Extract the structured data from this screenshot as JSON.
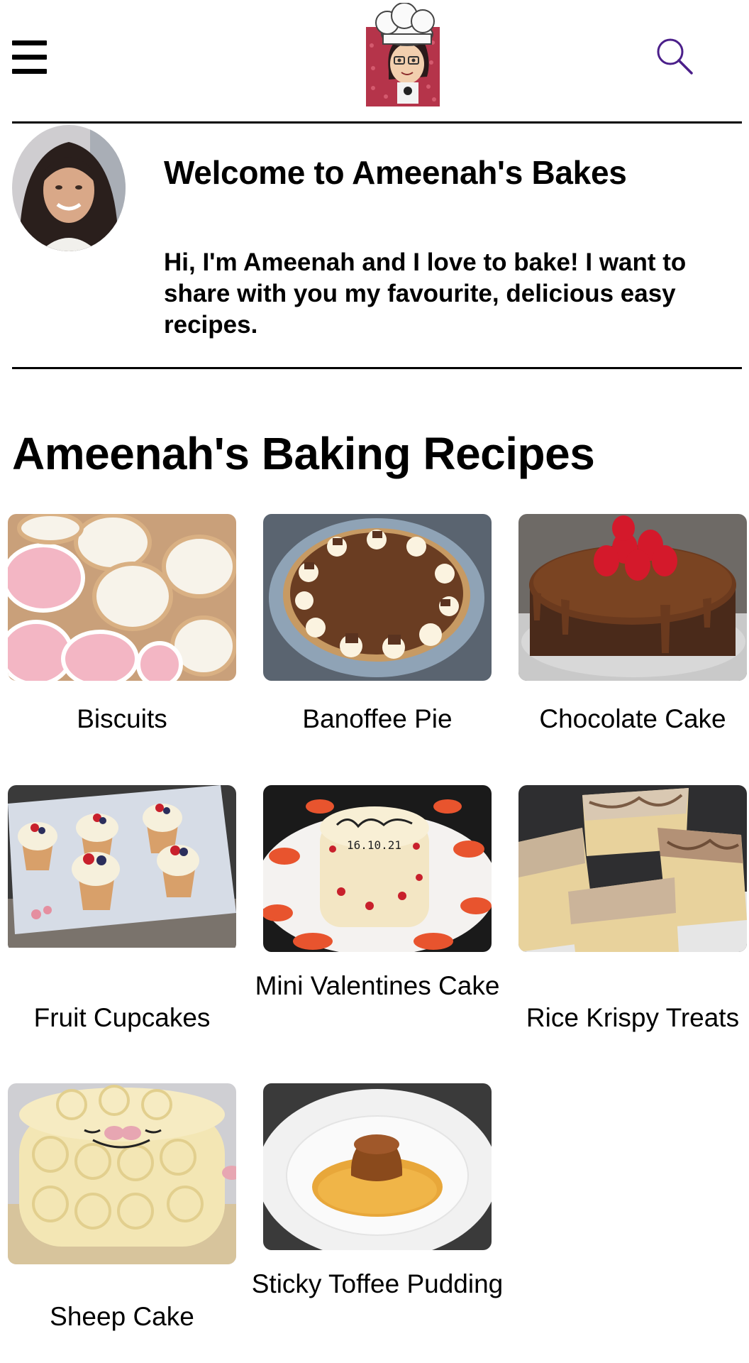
{
  "header": {
    "menu_icon": "hamburger-menu-icon",
    "logo": "chef-avatar-logo",
    "search_icon": "search-icon",
    "accent_color": "#4b1f8a"
  },
  "welcome": {
    "title": "Welcome to Ameenah's Bakes",
    "text": "Hi, I'm Ameenah and I love to bake! I want to share with you my favourite, delicious easy recipes."
  },
  "section": {
    "title": "Ameenah's Baking Recipes"
  },
  "recipes": [
    {
      "label": "Biscuits"
    },
    {
      "label": "Banoffee Pie"
    },
    {
      "label": "Chocolate Cake"
    },
    {
      "label": "Fruit Cupcakes"
    },
    {
      "label": "Mini Valentines Cake"
    },
    {
      "label": "Rice Krispy Treats"
    },
    {
      "label": "Sheep Cake"
    },
    {
      "label": "Sticky Toffee Pudding"
    }
  ]
}
